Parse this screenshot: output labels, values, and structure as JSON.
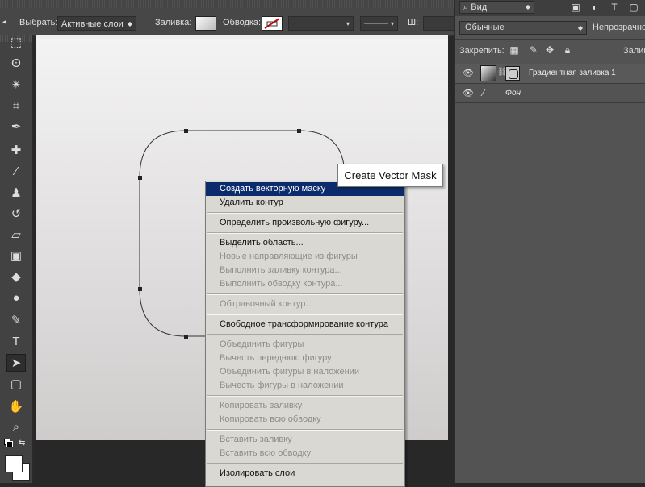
{
  "options_bar": {
    "select_label": "Выбрать:",
    "select_value": "Активные слои",
    "fill_label": "Заливка:",
    "stroke_label": "Обводка:",
    "width_label": "Ш:"
  },
  "tools": [
    {
      "name": "marquee-tool-icon",
      "glyph": "⬚"
    },
    {
      "name": "lasso-tool-icon",
      "glyph": "ʘ"
    },
    {
      "name": "magic-wand-tool-icon",
      "glyph": "✴"
    },
    {
      "name": "crop-tool-icon",
      "glyph": "⌗"
    },
    {
      "name": "eyedropper-tool-icon",
      "glyph": "✒"
    },
    {
      "name": "healing-brush-tool-icon",
      "glyph": "✚"
    },
    {
      "name": "brush-tool-icon",
      "glyph": "⁄"
    },
    {
      "name": "stamp-tool-icon",
      "glyph": "♟"
    },
    {
      "name": "history-brush-tool-icon",
      "glyph": "↺"
    },
    {
      "name": "eraser-tool-icon",
      "glyph": "▱"
    },
    {
      "name": "gradient-tool-icon",
      "glyph": "▣"
    },
    {
      "name": "blur-tool-icon",
      "glyph": "◆"
    },
    {
      "name": "dodge-tool-icon",
      "glyph": "●"
    },
    {
      "name": "pen-tool-icon",
      "glyph": "✎"
    },
    {
      "name": "type-tool-icon",
      "glyph": "T"
    },
    {
      "name": "path-selection-tool-icon",
      "glyph": "➤"
    },
    {
      "name": "shape-tool-icon",
      "glyph": "▢"
    },
    {
      "name": "hand-tool-icon",
      "glyph": "✋"
    },
    {
      "name": "zoom-tool-icon",
      "glyph": "⌕"
    }
  ],
  "layers_panel": {
    "filter_label": "Вид",
    "blend_mode": "Обычные",
    "opacity_label": "Непрозрачность",
    "lock_label": "Закрепить:",
    "fill_label": "Заливка",
    "layers": [
      {
        "name": "Градиентная заливка 1",
        "selected": true
      },
      {
        "name": "Фон",
        "selected": false
      }
    ]
  },
  "context_menu": {
    "items": [
      {
        "label": "Создать векторную маску",
        "disabled": false,
        "highlighted": true
      },
      {
        "label": "Удалить контур",
        "disabled": false
      },
      {
        "separator": true
      },
      {
        "label": "Определить произвольную фигуру...",
        "disabled": false
      },
      {
        "separator": true
      },
      {
        "label": "Выделить область...",
        "disabled": false
      },
      {
        "label": "Новые направляющие из фигуры",
        "disabled": true
      },
      {
        "label": "Выполнить заливку контура...",
        "disabled": true
      },
      {
        "label": "Выполнить обводку контура...",
        "disabled": true
      },
      {
        "separator": true
      },
      {
        "label": "Обтравочный контур...",
        "disabled": true
      },
      {
        "separator": true
      },
      {
        "label": "Свободное трансформирование контура",
        "disabled": false
      },
      {
        "separator": true
      },
      {
        "label": "Объединить фигуры",
        "disabled": true
      },
      {
        "label": "Вычесть переднюю фигуру",
        "disabled": true
      },
      {
        "label": "Объединить фигуры в наложении",
        "disabled": true
      },
      {
        "label": "Вычесть фигуры в наложении",
        "disabled": true
      },
      {
        "separator": true
      },
      {
        "label": "Копировать заливку",
        "disabled": true
      },
      {
        "label": "Копировать всю обводку",
        "disabled": true
      },
      {
        "separator": true
      },
      {
        "label": "Вставить заливку",
        "disabled": true
      },
      {
        "label": "Вставить всю обводку",
        "disabled": true
      },
      {
        "separator": true
      },
      {
        "label": "Изолировать слои",
        "disabled": false
      }
    ]
  },
  "tooltip": {
    "text": "Create Vector Mask"
  }
}
